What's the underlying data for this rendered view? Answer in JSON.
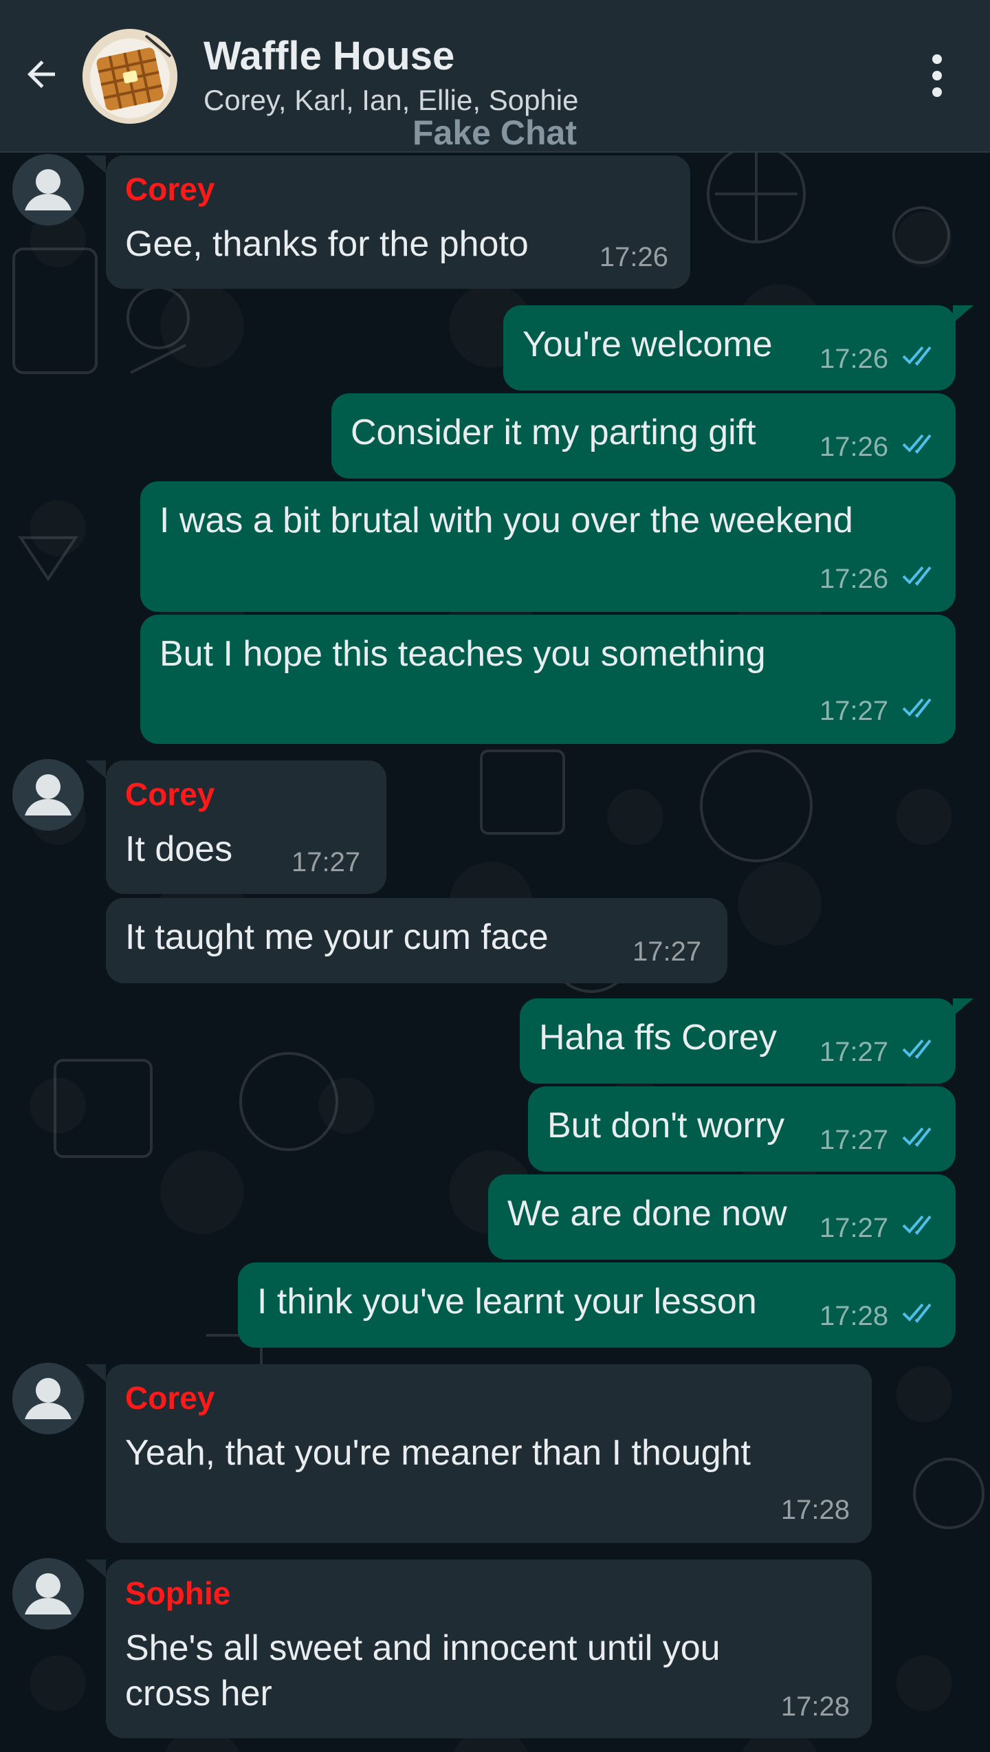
{
  "header": {
    "title": "Waffle House",
    "participants": "Corey, Karl, Ian, Ellie, Sophie",
    "watermark": "Fake Chat"
  },
  "colors": {
    "header_bg": "#1f2c33",
    "chat_bg": "#0b141a",
    "incoming_bubble": "#202c33",
    "outgoing_bubble": "#005c4b",
    "sender_name": "#ff1a1a",
    "read_ticks": "#53bdeb"
  },
  "icons": {
    "back": "arrow-left-icon",
    "menu": "kebab-menu-icon",
    "read": "double-check-icon",
    "default_avatar": "person-icon"
  },
  "messages": [
    {
      "sender": "Corey",
      "text": "Gee, thanks for the photo",
      "time": "17:26",
      "direction": "incoming"
    },
    {
      "text": "You're welcome",
      "time": "17:26",
      "direction": "outgoing"
    },
    {
      "text": "Consider it my parting gift",
      "time": "17:26",
      "direction": "outgoing"
    },
    {
      "text": "I was a bit brutal with you over the weekend",
      "time": "17:26",
      "direction": "outgoing"
    },
    {
      "text": "But I hope this teaches you something",
      "time": "17:27",
      "direction": "outgoing"
    },
    {
      "sender": "Corey",
      "text": "It does",
      "time": "17:27",
      "direction": "incoming"
    },
    {
      "text": "It taught me your cum face",
      "time": "17:27",
      "direction": "incoming"
    },
    {
      "text": "Haha ffs Corey",
      "time": "17:27",
      "direction": "outgoing"
    },
    {
      "text": "But don't worry",
      "time": "17:27",
      "direction": "outgoing"
    },
    {
      "text": "We are done now",
      "time": "17:27",
      "direction": "outgoing"
    },
    {
      "text": "I think you've learnt your lesson",
      "time": "17:28",
      "direction": "outgoing"
    },
    {
      "sender": "Corey",
      "text": "Yeah, that you're meaner than I thought",
      "time": "17:28",
      "direction": "incoming"
    },
    {
      "sender": "Sophie",
      "text_line1": "She's all sweet and innocent until you",
      "text_line2": "cross her",
      "time": "17:28",
      "direction": "incoming"
    }
  ]
}
